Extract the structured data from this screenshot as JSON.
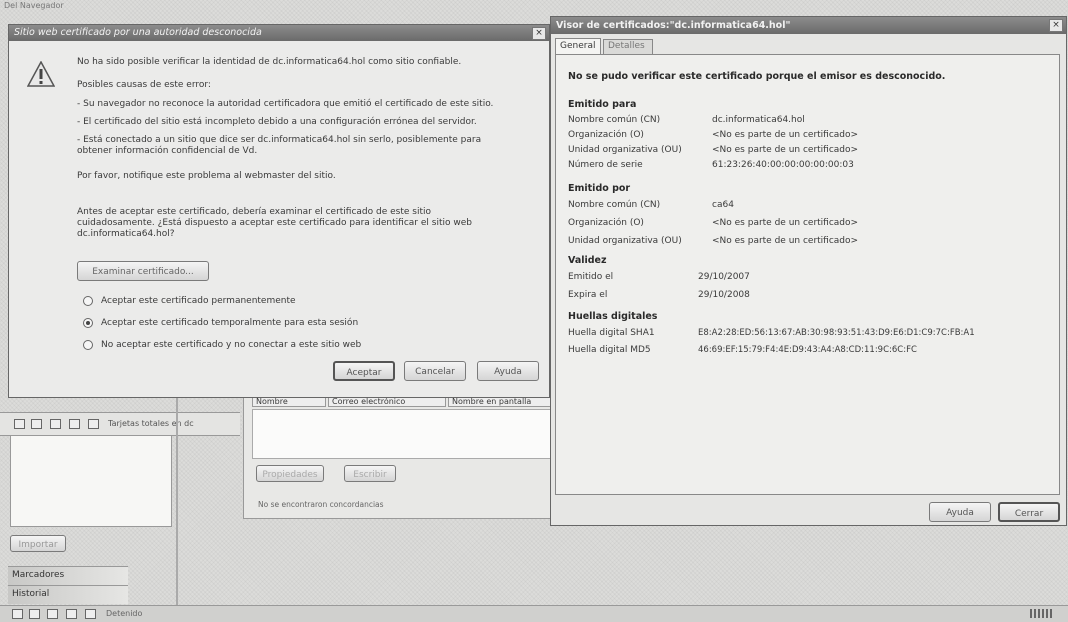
{
  "browser": {
    "bg_title": "Del Navegador",
    "toolbar_label": "Tarjetas totales en dc",
    "import_button": "Importar",
    "sidebar": {
      "bookmarks": "Marcadores",
      "history": "Historial"
    },
    "status_text": "Detenido"
  },
  "contacts_panel": {
    "columns": [
      "Nombre",
      "Correo electrónico",
      "Nombre en pantalla"
    ],
    "buttons": [
      "Propiedades",
      "Escribir"
    ],
    "status": "No se encontraron concordancias"
  },
  "security_dialog": {
    "title": "Sitio web certificado por una autoridad desconocida",
    "intro": "No ha sido posible verificar la identidad de dc.informatica64.hol como sitio confiable.",
    "causes_heading": "Posibles causas de este error:",
    "causes": [
      "- Su navegador no reconoce la autoridad certificadora que emitió el certificado de este sitio.",
      "- El certificado del sitio está incompleto debido a una configuración errónea del servidor.",
      "- Está conectado a un sitio que dice ser dc.informatica64.hol sin serlo, posiblemente para",
      "obtener información confidencial de Vd."
    ],
    "notify": "Por favor, notifique este problema al webmaster del sitio.",
    "advice": [
      "Antes de aceptar este certificado, debería examinar el certificado de este sitio",
      "cuidadosamente. ¿Está dispuesto a aceptar este certificado para identificar el sitio web",
      "dc.informatica64.hol?"
    ],
    "examine_button": "Examinar certificado...",
    "options": [
      {
        "label": "Aceptar este certificado permanentemente",
        "selected": false
      },
      {
        "label": "Aceptar este certificado temporalmente para esta sesión",
        "selected": true
      },
      {
        "label": "No aceptar este certificado y no conectar a este sitio web",
        "selected": false
      }
    ],
    "buttons": {
      "accept": "Aceptar",
      "cancel": "Cancelar",
      "help": "Ayuda"
    }
  },
  "cert_viewer": {
    "title": "Visor de certificados:\"dc.informatica64.hol\"",
    "tabs": [
      "General",
      "Detalles"
    ],
    "active_tab": "General",
    "warning": "No se pudo verificar este certificado porque el emisor es desconocido.",
    "issued_to": {
      "heading": "Emitido para",
      "rows": [
        [
          "Nombre común (CN)",
          "dc.informatica64.hol"
        ],
        [
          "Organización (O)",
          "<No es parte de un certificado>"
        ],
        [
          "Unidad organizativa (OU)",
          "<No es parte de un certificado>"
        ],
        [
          "Número de serie",
          "61:23:26:40:00:00:00:00:00:03"
        ]
      ]
    },
    "issued_by": {
      "heading": "Emitido por",
      "rows": [
        [
          "Nombre común (CN)",
          "ca64"
        ],
        [
          "Organización (O)",
          "<No es parte de un certificado>"
        ],
        [
          "Unidad organizativa (OU)",
          "<No es parte de un certificado>"
        ]
      ]
    },
    "validity": {
      "heading": "Validez",
      "rows": [
        [
          "Emitido el",
          "29/10/2007"
        ],
        [
          "Expira el",
          "29/10/2008"
        ]
      ]
    },
    "fingerprints": {
      "heading": "Huellas digitales",
      "rows": [
        [
          "Huella digital SHA1",
          "E8:A2:28:ED:56:13:67:AB:30:98:93:51:43:D9:E6:D1:C9:7C:FB:A1"
        ],
        [
          "Huella digital MD5",
          "46:69:EF:15:79:F4:4E:D9:43:A4:A8:CD:11:9C:6C:FC"
        ]
      ]
    },
    "buttons": {
      "help": "Ayuda",
      "close": "Cerrar"
    }
  }
}
